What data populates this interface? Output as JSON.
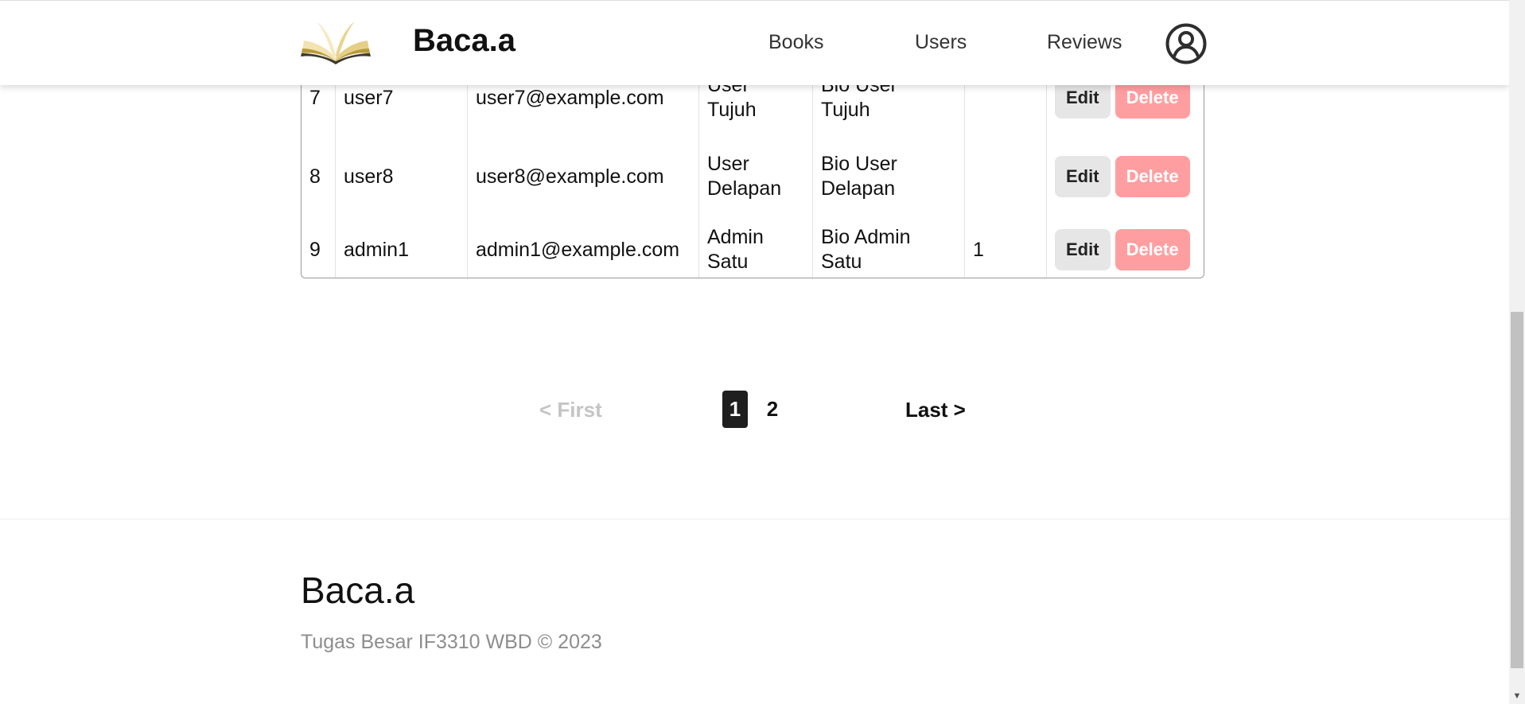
{
  "header": {
    "brand": "Baca.a",
    "nav": [
      "Books",
      "Users",
      "Reviews"
    ]
  },
  "table": {
    "rows": [
      {
        "id": "7",
        "username": "user7",
        "email": "user7@example.com",
        "name_line1": "User",
        "name_line2": "Tujuh",
        "bio_line1": "Bio User",
        "bio_line2": "Tujuh",
        "is_admin": "",
        "edit": "Edit",
        "delete": "Delete"
      },
      {
        "id": "8",
        "username": "user8",
        "email": "user8@example.com",
        "name_line1": "User",
        "name_line2": "Delapan",
        "bio_line1": "Bio User",
        "bio_line2": "Delapan",
        "is_admin": "",
        "edit": "Edit",
        "delete": "Delete"
      },
      {
        "id": "9",
        "username": "admin1",
        "email": "admin1@example.com",
        "name_line1": "Admin",
        "name_line2": "Satu",
        "bio_line1": "Bio Admin",
        "bio_line2": "Satu",
        "is_admin": "1",
        "edit": "Edit",
        "delete": "Delete"
      }
    ]
  },
  "pagination": {
    "first": "< First",
    "pages": [
      "1",
      "2"
    ],
    "current": "1",
    "last": "Last >"
  },
  "footer": {
    "brand": "Baca.a",
    "copyright": "Tugas Besar IF3310 WBD © 2023"
  },
  "colors": {
    "delete_button": "#ff9ea1",
    "edit_button": "#e6e6e6",
    "active_page": "#1f1f1f",
    "disabled_link": "#c4c4c4"
  }
}
